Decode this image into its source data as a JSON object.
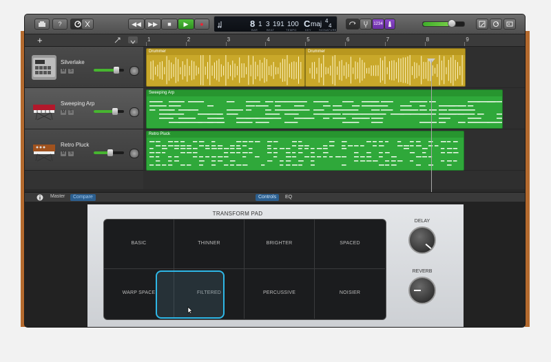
{
  "toolbar": {
    "library_icon": "library-icon",
    "help_label": "?",
    "smart_controls_icon": "smart-controls-icon",
    "editors_icon": "scissors-icon",
    "rewind_label": "◀◀",
    "forward_label": "▶▶",
    "stop_label": "■",
    "play_label": "▶",
    "record_label": "●",
    "cycle_icon": "cycle-icon",
    "tuner_icon": "tuner-icon",
    "count_in_label": "1234",
    "metronome_icon": "metronome-icon",
    "notepad_icon": "notepad-icon",
    "loops_icon": "loops-icon",
    "media_icon": "media-icon",
    "master_volume": 0.7
  },
  "lcd": {
    "bar": "8",
    "beat": "1",
    "sub_beat": "3",
    "tick": "191",
    "tempo": "100",
    "key": "C",
    "key_mode": "maj",
    "time_sig_top": "4",
    "time_sig_bottom": "4",
    "labels": [
      "BAR",
      "BEAT",
      "TEMPO",
      "KEY",
      "SIGNATURE"
    ]
  },
  "tracks_header": {
    "add_label": "+"
  },
  "ruler": {
    "marks": [
      "1",
      "2",
      "3",
      "4",
      "5",
      "6",
      "7",
      "8",
      "9"
    ]
  },
  "tracks": [
    {
      "name": "Silverlake",
      "volume": 0.75
    },
    {
      "name": "Sweeping Arp",
      "volume": 0.7
    },
    {
      "name": "Retro Pluck",
      "volume": 0.55
    }
  ],
  "regions": [
    {
      "name": "Drummer",
      "color": "#c9a82a"
    },
    {
      "name": "Drummer",
      "color": "#c9a82a"
    },
    {
      "name": "Sweeping Arp",
      "color": "#2fa83a"
    },
    {
      "name": "Retro Pluck",
      "color": "#2fa83a"
    }
  ],
  "smart_controls": {
    "info_icon": "info-icon",
    "master_label": "Master",
    "compare_label": "Compare",
    "controls_tab": "Controls",
    "eq_tab": "EQ"
  },
  "transform_pad": {
    "title": "TRANSFORM PAD",
    "cells": [
      "BASIC",
      "THINNER",
      "BRIGHTER",
      "SPACED",
      "WARP SPACE",
      "FILTERED",
      "PERCUSSIVE",
      "NOISIER"
    ]
  },
  "knobs": {
    "delay_label": "DELAY",
    "reverb_label": "REVERB"
  }
}
